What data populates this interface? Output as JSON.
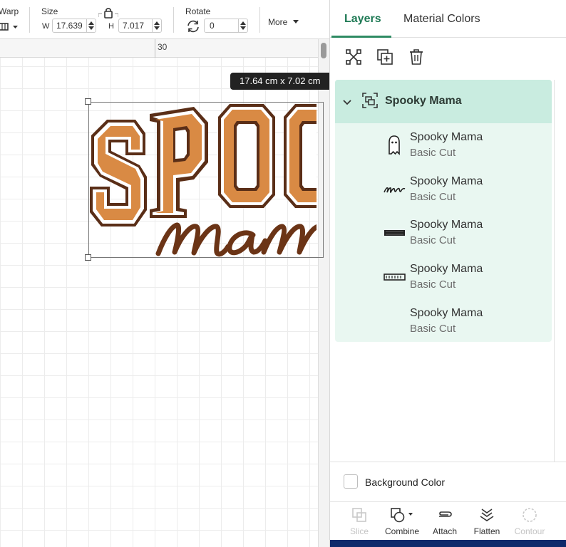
{
  "toolbar": {
    "warp_label": "Warp",
    "size_label": "Size",
    "width_prefix": "W",
    "width_value": "17.639",
    "height_prefix": "H",
    "height_value": "7.017",
    "rotate_label": "Rotate",
    "rotate_value": "0",
    "more_label": "More"
  },
  "canvas": {
    "ruler_label": "30",
    "size_tooltip": "17.64  cm x 7.02  cm",
    "design": {
      "word_top": "SPOOKY",
      "word_bottom": "mama",
      "letters_visible": "SPOO",
      "script_visible": "mam",
      "colors": {
        "fill": "#d98a44",
        "outline": "#5a2e17",
        "inner_line": "#ffffff",
        "script": "#6b3416"
      }
    }
  },
  "panel": {
    "tabs": [
      {
        "label": "Layers",
        "active": true
      },
      {
        "label": "Material Colors",
        "active": false
      }
    ],
    "tools": [
      "group-icon",
      "duplicate-icon",
      "delete-icon"
    ],
    "group": {
      "title": "Spooky Mama",
      "expanded": true
    },
    "layers": [
      {
        "name": "Spooky Mama",
        "operation": "Basic Cut",
        "thumbnail": "ghost-icon"
      },
      {
        "name": "Spooky Mama",
        "operation": "Basic Cut",
        "thumbnail": "mama-script-icon"
      },
      {
        "name": "Spooky Mama",
        "operation": "Basic Cut",
        "thumbnail": "spooky-text-icon"
      },
      {
        "name": "Spooky Mama",
        "operation": "Basic Cut",
        "thumbnail": "spooky-outline-icon"
      },
      {
        "name": "Spooky Mama",
        "operation": "Basic Cut",
        "thumbnail": ""
      }
    ],
    "background_label": "Background Color",
    "bottom_tools": [
      {
        "label": "Slice",
        "enabled": false
      },
      {
        "label": "Combine",
        "enabled": true
      },
      {
        "label": "Attach",
        "enabled": true
      },
      {
        "label": "Flatten",
        "enabled": true
      },
      {
        "label": "Contour",
        "enabled": false
      }
    ]
  },
  "colors": {
    "accent": "#2e8b63",
    "layer_group_bg": "#c9ece0",
    "layer_list_bg": "#e9f7f1",
    "footer": "#0e2a6b"
  }
}
